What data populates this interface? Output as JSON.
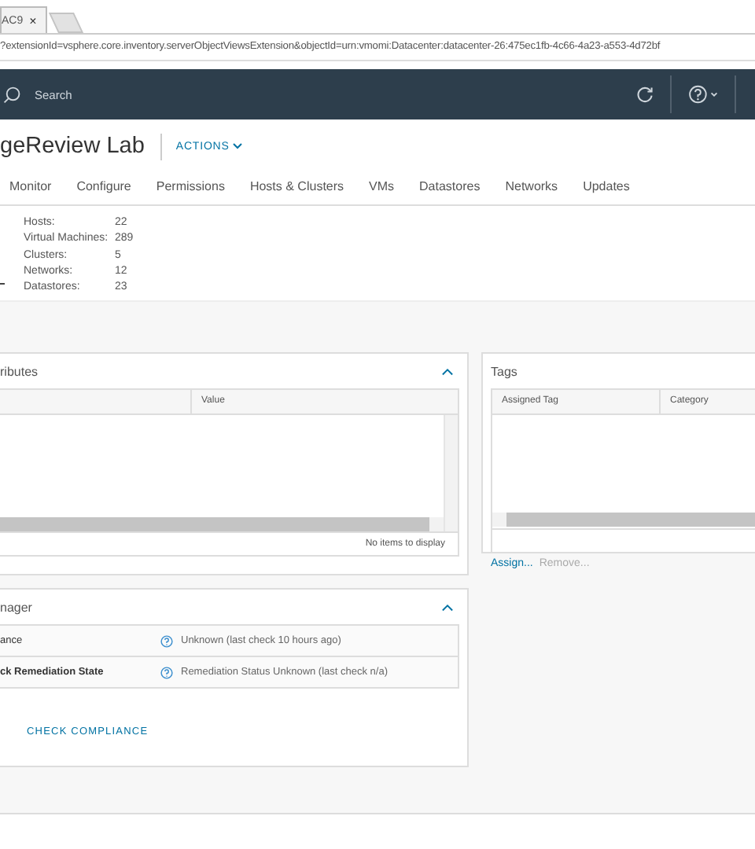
{
  "browser": {
    "tab_title": "AC9",
    "tab_close": "×",
    "url": "?extensionId=vsphere.core.inventory.serverObjectViewsExtension&objectId=urn:vmomi:Datacenter:datacenter-26:475ec1fb-4c66-4a23-a553-4d72bf"
  },
  "header": {
    "search_placeholder": "Search"
  },
  "title": "geReview Lab",
  "actions": "ACTIONS",
  "tabs": [
    {
      "label": "Monitor",
      "selected": false
    },
    {
      "label": "Configure",
      "selected": false
    },
    {
      "label": "Permissions",
      "selected": false
    },
    {
      "label": "Hosts & Clusters",
      "selected": false
    },
    {
      "label": "VMs",
      "selected": false
    },
    {
      "label": "Datastores",
      "selected": false
    },
    {
      "label": "Networks",
      "selected": false
    },
    {
      "label": "Updates",
      "selected": false
    }
  ],
  "summary": [
    {
      "label": "Hosts:",
      "value": "22"
    },
    {
      "label": "Virtual Machines:",
      "value": "289"
    },
    {
      "label": "Clusters:",
      "value": "5"
    },
    {
      "label": "Networks:",
      "value": "12"
    },
    {
      "label": "Datastores:",
      "value": "23"
    }
  ],
  "attributes_panel": {
    "title": "ributes",
    "columns": [
      "Value"
    ],
    "footer": "No items to display"
  },
  "tags_panel": {
    "title": "Tags",
    "columns": [
      "Assigned Tag",
      "Category"
    ],
    "links": [
      {
        "label": "Assign...",
        "disabled": false
      },
      {
        "label": "Remove...",
        "disabled": true
      }
    ]
  },
  "update_panel": {
    "title": "nager",
    "rows": [
      {
        "label": "ance",
        "status": "Unknown (last check 10 hours ago)"
      },
      {
        "label": "ck Remediation State",
        "status": "Remediation Status Unknown (last check n/a)"
      }
    ],
    "button": "CHECK COMPLIANCE"
  }
}
